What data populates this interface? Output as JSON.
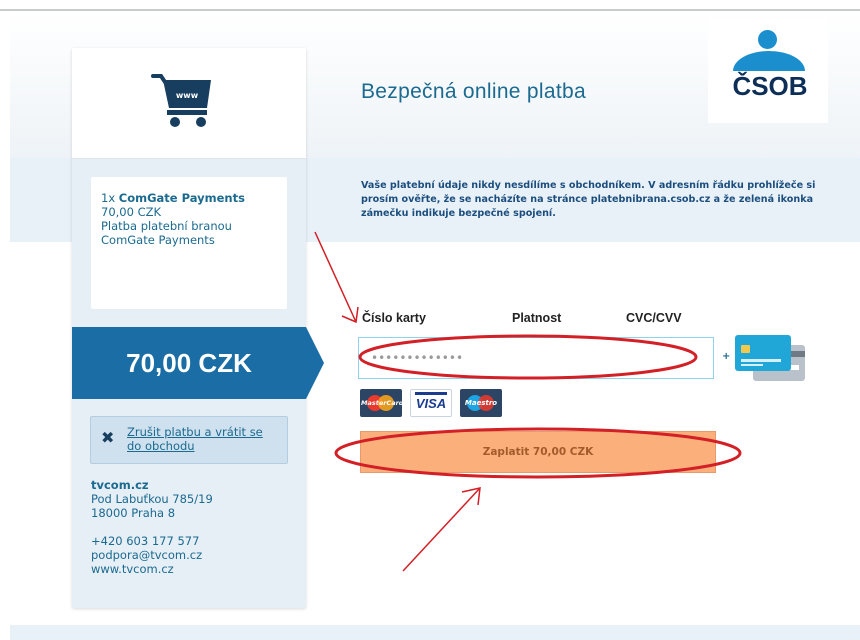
{
  "header": {
    "title": "Bezpečná online platba",
    "logo_text": "ČSOB",
    "cart_icon_label": "www"
  },
  "order": {
    "quantity": "1x",
    "product": "ComGate Payments",
    "price": "70,00 CZK",
    "description": "Platba platební branou ComGate Payments",
    "total": "70,00 CZK"
  },
  "cancel": {
    "label": "Zrušit platbu a vrátit se do obchodu"
  },
  "merchant": {
    "name": "tvcom.cz",
    "street": "Pod Labuťkou 785/19",
    "city": "18000 Praha 8",
    "phone": "+420 603 177 577",
    "email": "podpora@tvcom.cz",
    "web": "www.tvcom.cz"
  },
  "info": {
    "text": "Vaše platební údaje nikdy nesdílíme s obchodníkem. V adresním řádku prohlížeče si prosím ověřte, že se nacházíte na stránce platebnibrana.csob.cz a že zelená ikonka zámečku indikuje bezpečné spojení."
  },
  "form": {
    "card_number_label": "Číslo karty",
    "expiry_label": "Platnost",
    "cvc_label": "CVC/CVV",
    "card_number_placeholder": "•••••••••••••",
    "plus": "+",
    "card_brands": [
      "MasterCard",
      "VISA",
      "Maestro"
    ],
    "pay_button": "Zaplatit 70,00 CZK"
  },
  "colors": {
    "brand_blue": "#1b6ea5",
    "text_blue": "#1b6a90",
    "pay_orange": "#fbb07b",
    "annotation_red": "#d31f26"
  }
}
